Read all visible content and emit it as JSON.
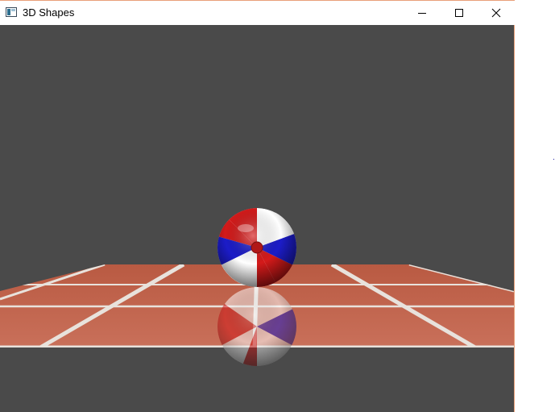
{
  "window": {
    "title": "3D Shapes",
    "controls": {
      "minimize_icon": "minimize-icon",
      "maximize_icon": "maximize-icon",
      "close_icon": "close-icon"
    }
  },
  "scene": {
    "background_color": "#4a4a4a",
    "floor_tile_color": "#c5684e",
    "floor_grout_color": "#e8e2dc",
    "ball_colors": [
      "#d41a1a",
      "#ffffff",
      "#1c1cc8"
    ]
  }
}
